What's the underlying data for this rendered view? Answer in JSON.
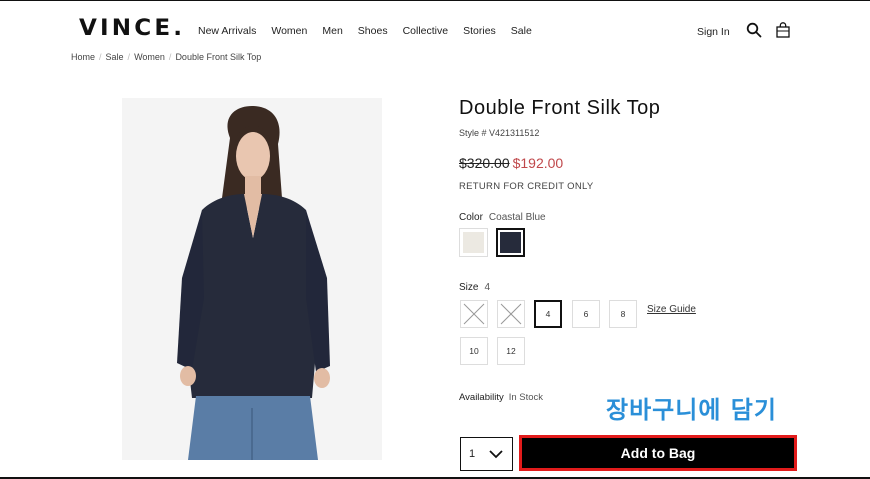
{
  "header": {
    "logo": "VINCE.",
    "nav": [
      "New Arrivals",
      "Women",
      "Men",
      "Shoes",
      "Collective",
      "Stories",
      "Sale"
    ],
    "sign_in": "Sign In",
    "search_icon": "search-icon",
    "bag_icon": "shopping-bag-icon"
  },
  "breadcrumb": [
    "Home",
    "Sale",
    "Women",
    "Double Front Silk Top"
  ],
  "product": {
    "title": "Double Front Silk Top",
    "style_line": "Style # V421311512",
    "original_price": "$320.00",
    "sale_price": "$192.00",
    "return_note": "RETURN FOR CREDIT ONLY",
    "color_label": "Color",
    "color_value": "Coastal Blue",
    "swatches": [
      {
        "name": "cream",
        "hex": "#ece9e2"
      },
      {
        "name": "coastal-blue",
        "hex": "#262b3b"
      }
    ],
    "size_label": "Size",
    "size_value": "4",
    "sizes": [
      {
        "label": "",
        "available": false
      },
      {
        "label": "",
        "available": false
      },
      {
        "label": "4",
        "available": true,
        "selected": true
      },
      {
        "label": "6",
        "available": true
      },
      {
        "label": "8",
        "available": true
      },
      {
        "label": "10",
        "available": true
      },
      {
        "label": "12",
        "available": true
      }
    ],
    "size_guide": "Size Guide",
    "availability_label": "Availability",
    "availability_value": "In Stock",
    "quantity": "1",
    "add_to_bag": "Add to Bag"
  },
  "annotation": {
    "text": "장바구니에 담기",
    "color": "#2a8fd8",
    "highlight_color": "#e21b1b"
  },
  "colors": {
    "sale_price": "#c0484b",
    "button_bg": "#000000"
  }
}
